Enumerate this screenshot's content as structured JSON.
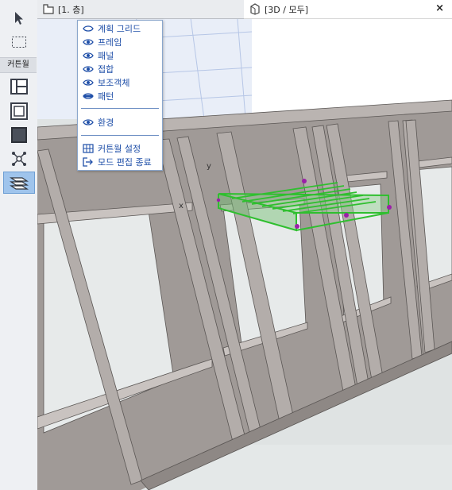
{
  "toolbox": {
    "section_label": "커튼월",
    "tools": [
      {
        "name": "arrow-tool-icon"
      },
      {
        "name": "marquee-tool-icon"
      },
      {
        "name": "curtain-wall-grid-icon"
      },
      {
        "name": "frame-tool-icon"
      },
      {
        "name": "panel-tool-icon"
      },
      {
        "name": "junction-tool-icon"
      },
      {
        "name": "accessory-tool-icon"
      }
    ]
  },
  "tabs": {
    "plan_label": "[1. 층]",
    "view3d_label": "[3D / 모두]",
    "close_glyph": "×"
  },
  "menu": {
    "items": [
      {
        "label": "계획 그리드"
      },
      {
        "label": "프레임"
      },
      {
        "label": "패널"
      },
      {
        "label": "접합"
      },
      {
        "label": "보조객체"
      },
      {
        "label": "패턴"
      }
    ],
    "environment_label": "환경",
    "settings_label": "커튼월 설정",
    "exit_label": "모드 편집 종료"
  },
  "axes": {
    "x": "x",
    "y": "y"
  },
  "colors": {
    "selection": "#2fbf2f",
    "hotspot": "#9b1fa8",
    "menu_text": "#1f4fa8",
    "wall": "#a09a97",
    "glass": "#e7eaea"
  }
}
